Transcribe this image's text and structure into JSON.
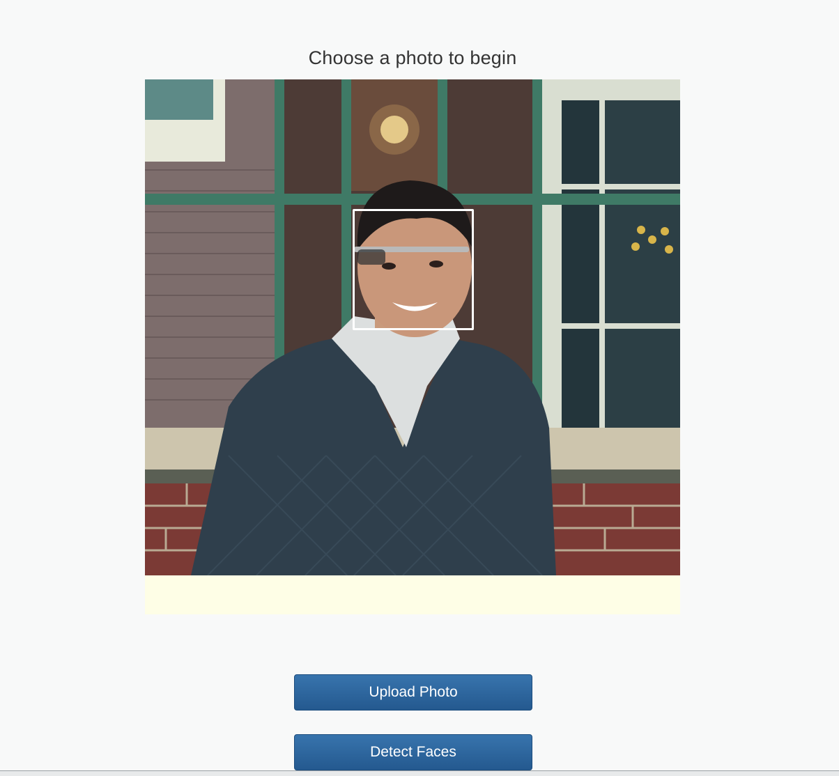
{
  "header": {
    "title": "Choose a photo to begin"
  },
  "photo": {
    "subject": "portrait of a smiling man wearing glasses and a dark sweater in front of a brick building window",
    "face_detected": true
  },
  "actions": {
    "upload_label": "Upload Photo",
    "detect_label": "Detect Faces"
  },
  "colors": {
    "button": "#2d669e",
    "page_background": "#f8f9f9",
    "photo_letterbox": "#fefee6"
  }
}
